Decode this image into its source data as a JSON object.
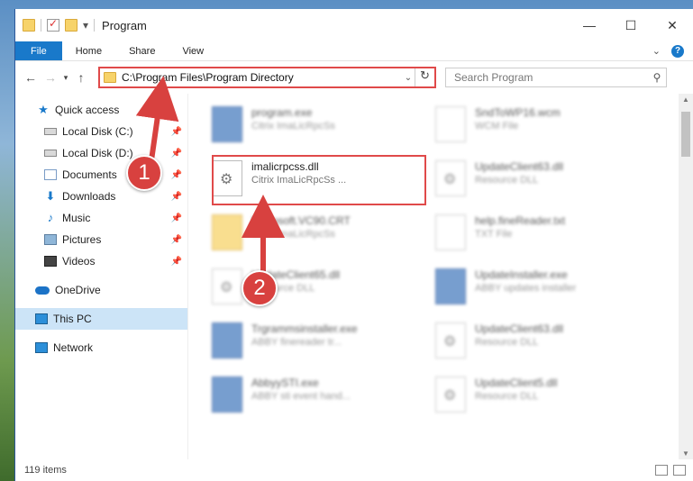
{
  "window": {
    "title": "Program",
    "controls": [
      "—",
      "☐",
      "✕"
    ]
  },
  "ribbon": {
    "tabs": [
      "File",
      "Home",
      "Share",
      "View"
    ],
    "help": "?"
  },
  "address": {
    "path": "C:\\Program Files\\Program Directory",
    "search_placeholder": "Search Program"
  },
  "nav": {
    "items": [
      {
        "label": "Quick access",
        "icon": "star-icon"
      },
      {
        "label": "Local Disk (C:)",
        "icon": "drive-icon",
        "pinned": true
      },
      {
        "label": "Local Disk (D:)",
        "icon": "drive-icon",
        "pinned": true
      },
      {
        "label": "Documents",
        "icon": "documents-icon",
        "pinned": true
      },
      {
        "label": "Downloads",
        "icon": "download-icon",
        "pinned": true
      },
      {
        "label": "Music",
        "icon": "music-icon",
        "pinned": true
      },
      {
        "label": "Pictures",
        "icon": "pictures-icon",
        "pinned": true
      },
      {
        "label": "Videos",
        "icon": "videos-icon",
        "pinned": true
      },
      {
        "label": "OneDrive",
        "icon": "cloud-icon"
      },
      {
        "label": "This PC",
        "icon": "pc-icon",
        "selected": true
      },
      {
        "label": "Network",
        "icon": "network-icon"
      }
    ]
  },
  "files": [
    {
      "name": "program.exe",
      "desc": "Citrix ImaLicRpcSs",
      "type": "exe"
    },
    {
      "name": "SndToWP16.wcm",
      "desc": "WCM File",
      "type": "file"
    },
    {
      "name": "imalicrpcss.dll",
      "desc": "Citrix ImaLicRpcSs ...",
      "type": "dll"
    },
    {
      "name": "UpdateClient63.dll",
      "desc": "Resource DLL",
      "type": "dll"
    },
    {
      "name": "Microsoft.VC90.CRT",
      "desc": "Citrix ImaLicRpcSs",
      "type": "folder"
    },
    {
      "name": "help.fineReader.txt",
      "desc": "TXT File",
      "type": "file"
    },
    {
      "name": "UpdateClient65.dll",
      "desc": "Resource DLL",
      "type": "dll"
    },
    {
      "name": "UpdateInstaller.exe",
      "desc": "ABBY updates installer",
      "type": "exe"
    },
    {
      "name": "Trgrammsinstaller.exe",
      "desc": "ABBY finereader tr...",
      "type": "exe"
    },
    {
      "name": "UpdateClient63.dll",
      "desc": "Resource DLL",
      "type": "dll"
    },
    {
      "name": "AbbyySTI.exe",
      "desc": "ABBY sti event hand...",
      "type": "exe"
    },
    {
      "name": "UpdateClient5.dll",
      "desc": "Resource DLL",
      "type": "dll"
    }
  ],
  "status": {
    "count": "119 items"
  },
  "callouts": [
    "1",
    "2"
  ],
  "colors": {
    "accent": "#1979ca",
    "highlight": "#e04a4a"
  }
}
